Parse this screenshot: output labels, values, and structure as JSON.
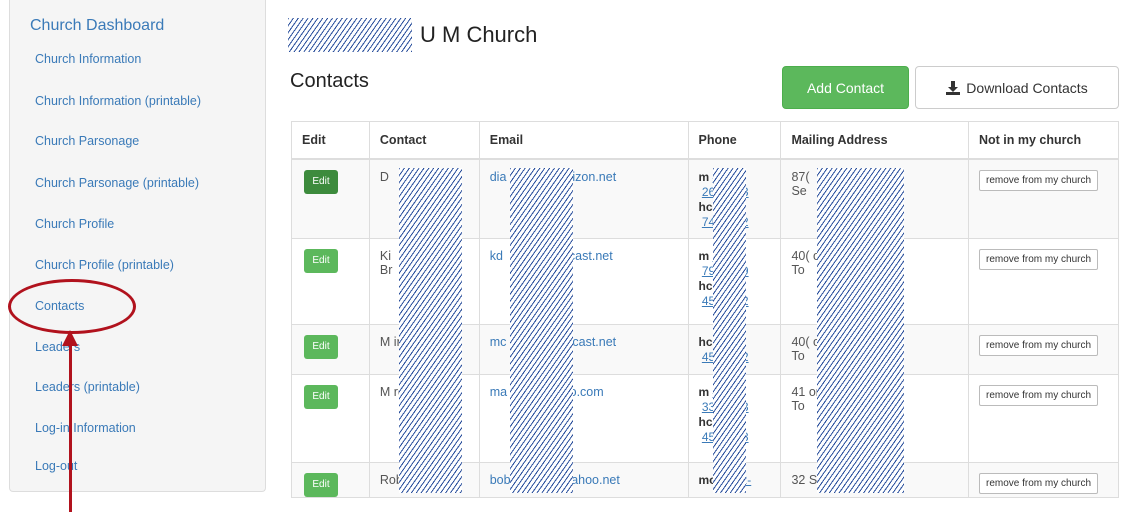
{
  "sidebar": {
    "title": "Church Dashboard",
    "items": [
      {
        "label": "Church Information"
      },
      {
        "label": "Church Information (printable)"
      },
      {
        "label": "Church Parsonage"
      },
      {
        "label": "Church Parsonage (printable)"
      },
      {
        "label": "Church Profile"
      },
      {
        "label": "Church Profile (printable)"
      },
      {
        "label": "Contacts"
      },
      {
        "label": "Leaders"
      },
      {
        "label": "Leaders (printable)"
      },
      {
        "label": "Log-in Information"
      },
      {
        "label": "Log-out"
      }
    ]
  },
  "header": {
    "church_name": "U M Church",
    "section_title": "Contacts"
  },
  "actions": {
    "add_label": "Add Contact",
    "download_label": "Download Contacts"
  },
  "table": {
    "headers": [
      "Edit",
      "Contact",
      "Email",
      "Phone",
      "Mailing Address",
      "Not in my church"
    ],
    "edit_label": "Edit",
    "remove_label": "remove from my church",
    "rows": [
      {
        "contact": "D",
        "email": "dia              verizon.net",
        "phone": [
          [
            "m",
            "412-"
          ],
          [
            "",
            "26        3"
          ],
          [
            "hc",
            "12-"
          ],
          [
            "",
            "74        2"
          ]
        ],
        "address": "87(\nSe"
      },
      {
        "contact": "Ki\nBr",
        "email": "kd              omcast.net",
        "phone": [
          [
            "m",
            "724-"
          ],
          [
            "",
            "79        9"
          ],
          [
            "hc",
            "24-"
          ],
          [
            "",
            "45        2"
          ]
        ],
        "address": "40(                  on\nTo"
      },
      {
        "contact": "M                in",
        "email": "mc              omcast.net",
        "phone": [
          [
            "hc",
            "24-"
          ],
          [
            "",
            "45        2"
          ]
        ],
        "address": "40(                  on\nTo"
      },
      {
        "contact": "M                rd",
        "email": "ma              hoo.com",
        "phone": [
          [
            "m",
            "412-"
          ],
          [
            "",
            "33        3"
          ],
          [
            "hc",
            "724)"
          ],
          [
            "",
            "45        8"
          ]
        ],
        "address": "41                   on\nTo"
      },
      {
        "contact": "Rober  D",
        "email": "bob            @yahoo.net",
        "phone": [
          [
            "mob",
            "412-"
          ]
        ],
        "address": "32 S Robert Ave PA"
      }
    ]
  }
}
